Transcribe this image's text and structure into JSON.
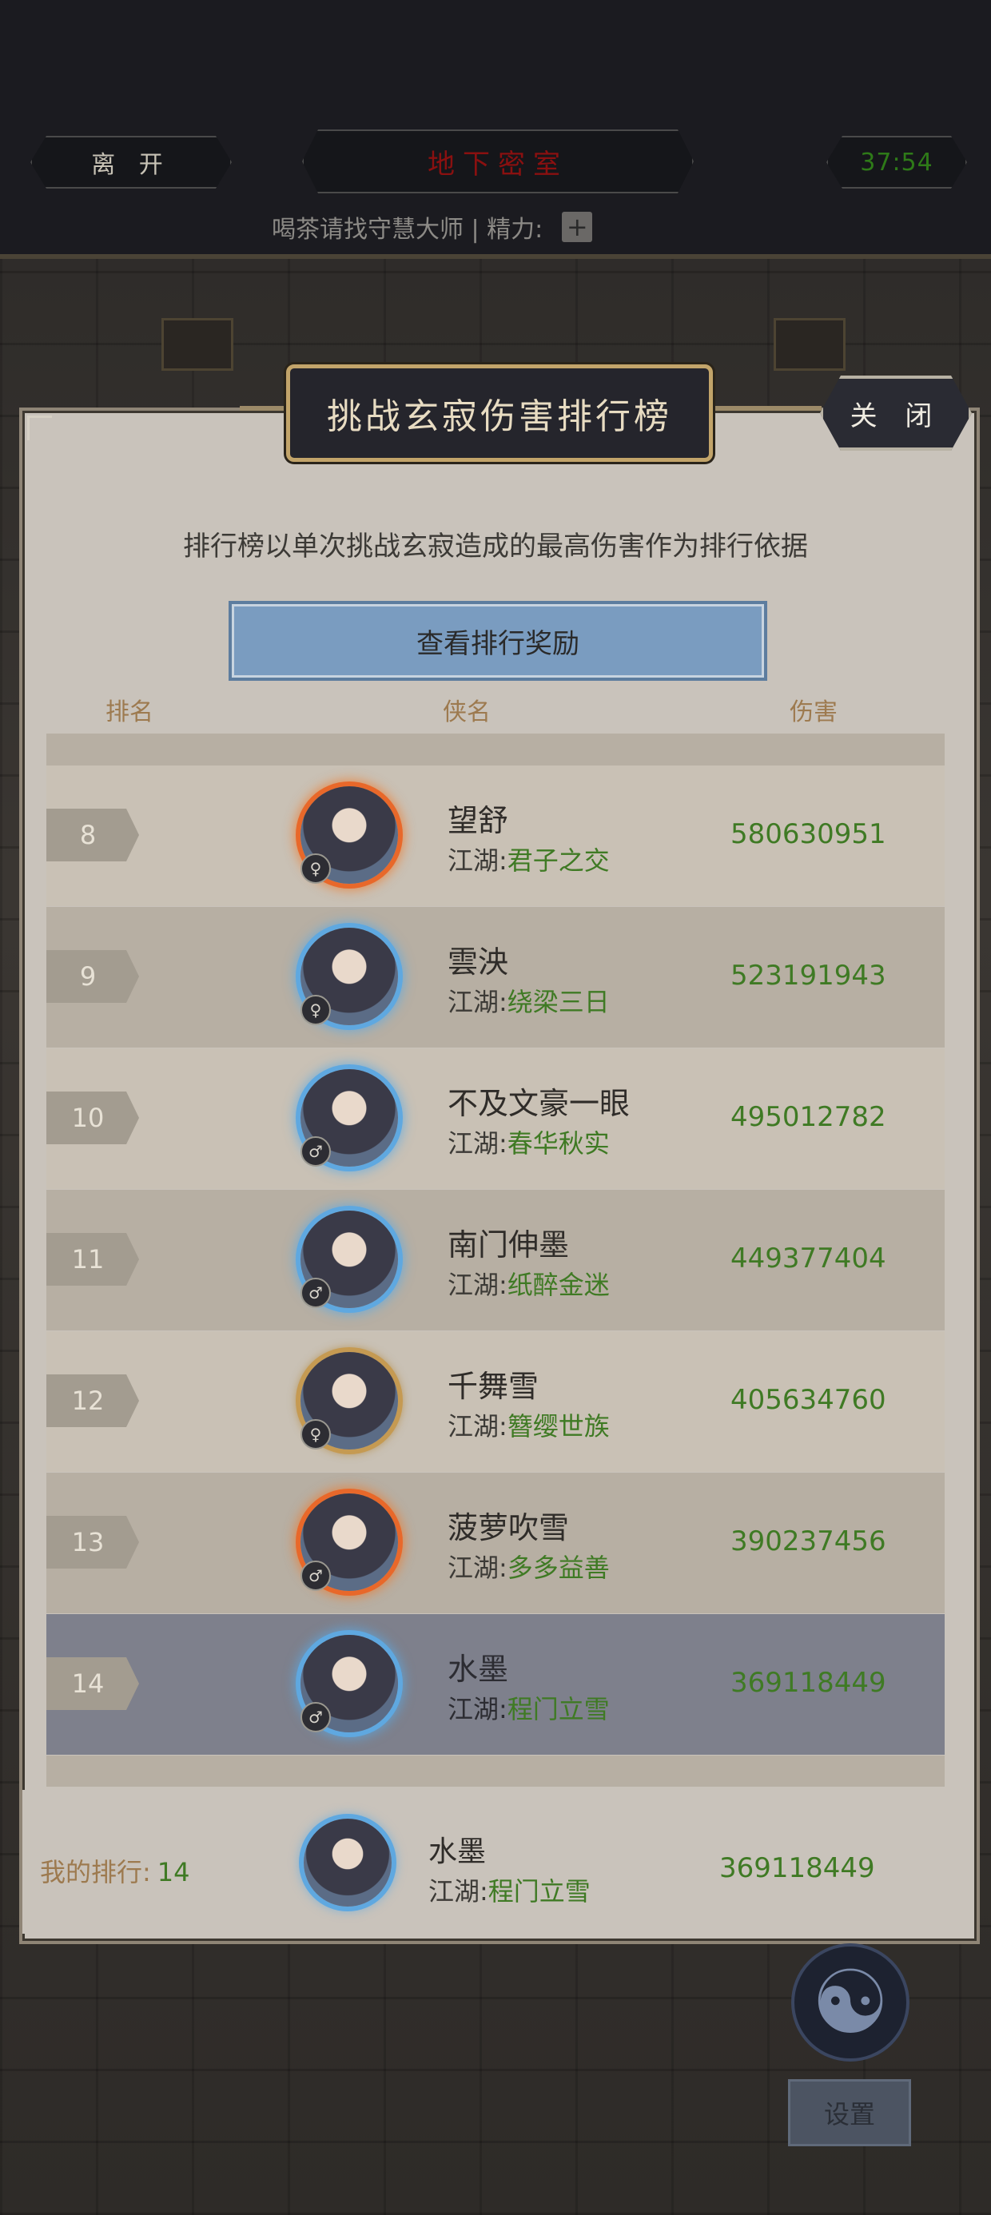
{
  "header": {
    "leave_label": "离 开",
    "location": "地下密室",
    "timer": "37:54",
    "subtitle_prefix": "喝茶请找守慧大师 | 精力:",
    "energy_value": "",
    "plus_label": "+"
  },
  "panel": {
    "title": "挑战玄寂伤害排行榜",
    "close_label": "关 闭",
    "description": "排行榜以单次挑战玄寂造成的最高伤害作为排行依据",
    "reward_button": "查看排行奖励",
    "columns": {
      "rank": "排名",
      "name": "侠名",
      "damage": "伤害"
    }
  },
  "rows": [
    {
      "rank": "8",
      "name": "望舒",
      "guild_prefix": "江湖:",
      "guild": "君子之交",
      "damage": "580630951",
      "gender": "♀",
      "frame": "fire"
    },
    {
      "rank": "9",
      "name": "雲泱",
      "guild_prefix": "江湖:",
      "guild": "绕梁三日",
      "damage": "523191943",
      "gender": "♀",
      "frame": "ice"
    },
    {
      "rank": "10",
      "name": "不及文豪一眼",
      "guild_prefix": "江湖:",
      "guild": "春华秋实",
      "damage": "495012782",
      "gender": "♂",
      "frame": "ice"
    },
    {
      "rank": "11",
      "name": "南门伸墨",
      "guild_prefix": "江湖:",
      "guild": "纸醉金迷",
      "damage": "449377404",
      "gender": "♂",
      "frame": "ice"
    },
    {
      "rank": "12",
      "name": "千舞雪",
      "guild_prefix": "江湖:",
      "guild": "簪缨世族",
      "damage": "405634760",
      "gender": "♀",
      "frame": "gold"
    },
    {
      "rank": "13",
      "name": "菠萝吹雪",
      "guild_prefix": "江湖:",
      "guild": "多多益善",
      "damage": "390237456",
      "gender": "♂",
      "frame": "fire"
    },
    {
      "rank": "14",
      "name": "水墨",
      "guild_prefix": "江湖:",
      "guild": "程门立雪",
      "damage": "369118449",
      "gender": "♂",
      "frame": "ice"
    }
  ],
  "my_rank": {
    "label": "我的排行:",
    "rank": "14",
    "name": "水墨",
    "guild_prefix": "江湖:",
    "guild": "程门立雪",
    "damage": "369118449"
  },
  "bottom": {
    "taiji_icon": "taiji-icon",
    "settings_label": "设置"
  },
  "colors": {
    "accent_green": "#3f7a24",
    "highlight_row": "#7e808c",
    "reward_button": "#7a9cc0"
  }
}
